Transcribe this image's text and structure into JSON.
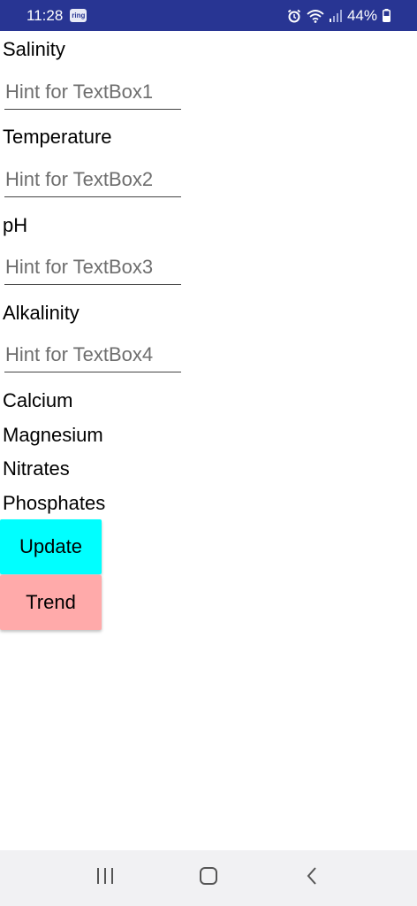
{
  "status_bar": {
    "time": "11:28",
    "notification_badge": "ring",
    "battery": "44%",
    "icons": [
      "alarm-icon",
      "wifi-icon",
      "signal-icon",
      "battery-icon"
    ]
  },
  "form": {
    "fields": [
      {
        "label": "Salinity",
        "placeholder": "Hint for TextBox1",
        "value": ""
      },
      {
        "label": "Temperature",
        "placeholder": "Hint for TextBox2",
        "value": ""
      },
      {
        "label": "pH",
        "placeholder": "Hint for TextBox3",
        "value": ""
      },
      {
        "label": "Alkalinity",
        "placeholder": "Hint for TextBox4",
        "value": ""
      }
    ],
    "extra_labels": [
      "Calcium",
      "Magnesium",
      "Nitrates",
      "Phosphates"
    ]
  },
  "buttons": {
    "update_label": "Update",
    "update_color": "#00ffff",
    "trend_label": "Trend",
    "trend_color": "#ffaaaa"
  },
  "nav_bar": {
    "icons": [
      "recent-apps-icon",
      "home-icon",
      "back-icon"
    ]
  },
  "colors": {
    "status_bar": "#283593",
    "nav_bar": "#f1f1f3"
  }
}
